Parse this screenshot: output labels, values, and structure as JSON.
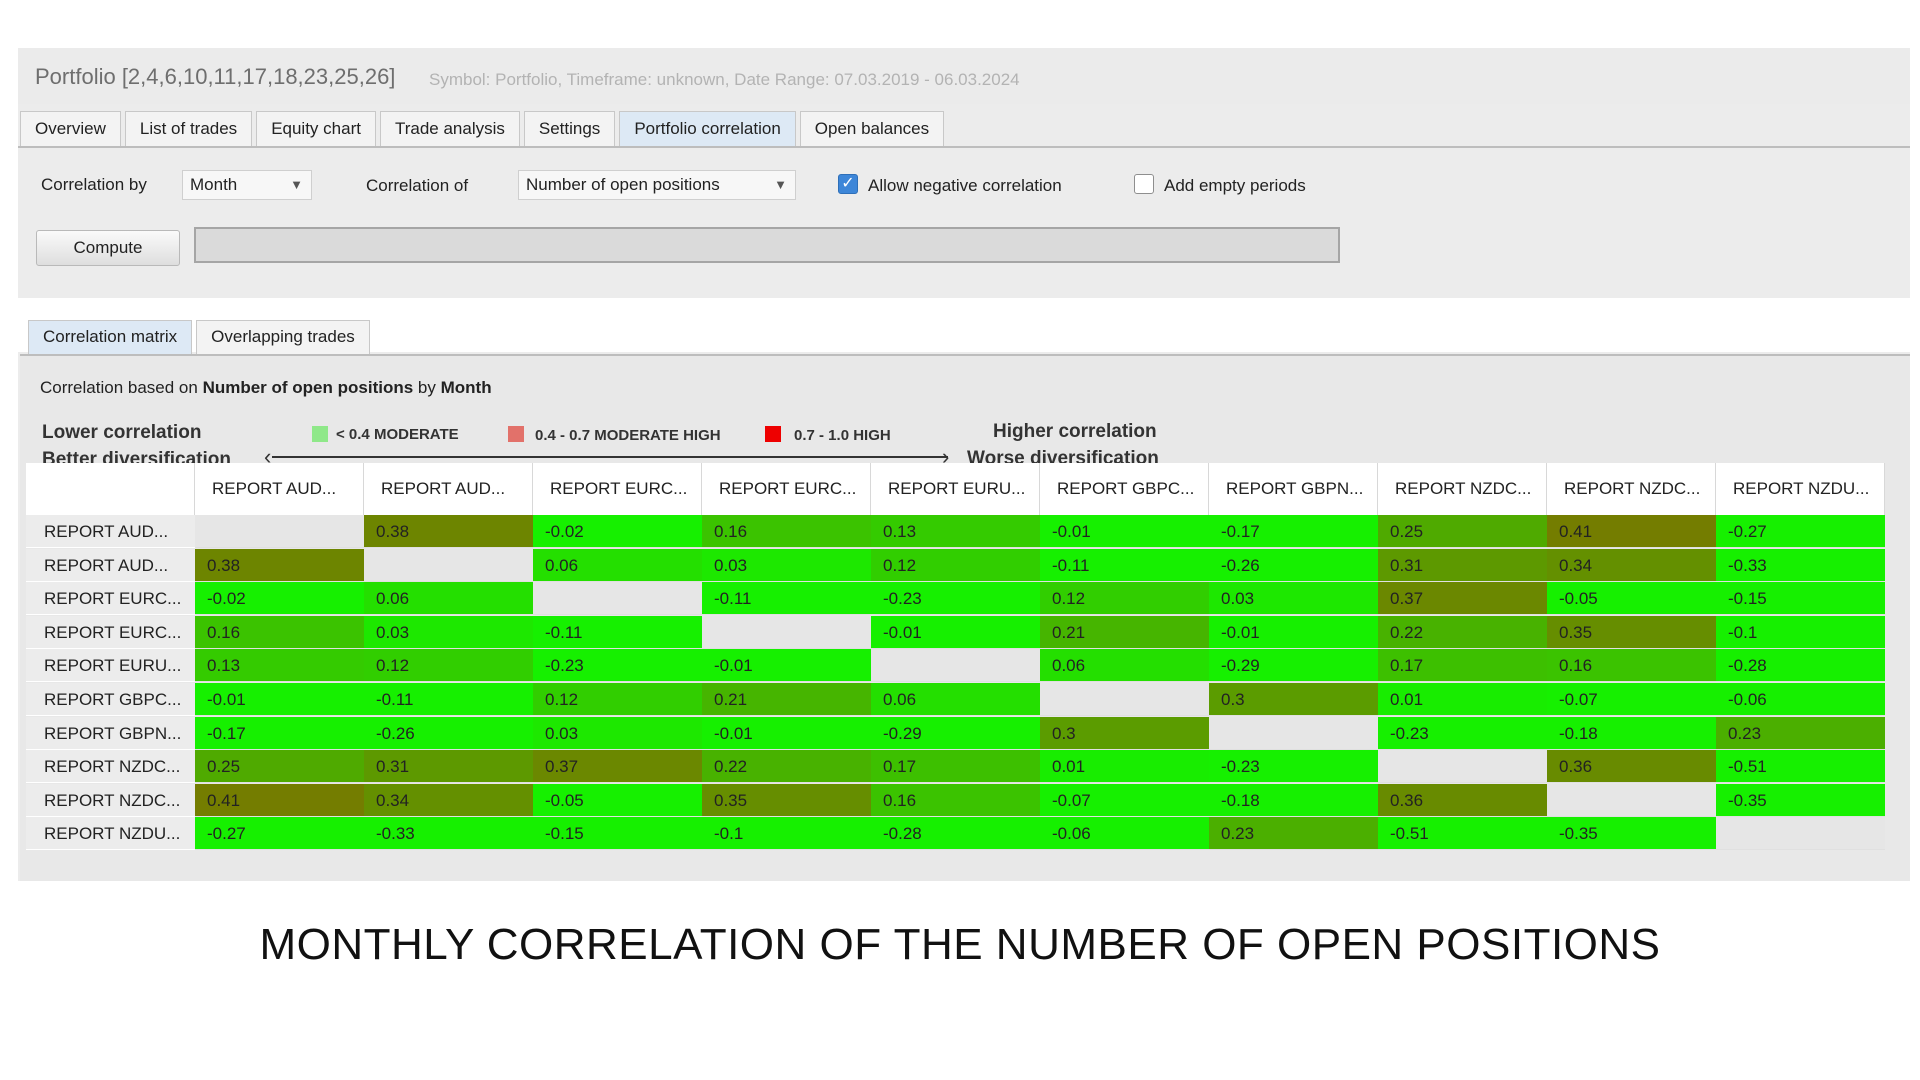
{
  "header": {
    "title": "Portfolio [2,4,6,10,11,17,18,23,25,26]",
    "subtitle": "Symbol: Portfolio, Timeframe: unknown, Date Range: 07.03.2019 - 06.03.2024"
  },
  "tabs": [
    "Overview",
    "List of trades",
    "Equity chart",
    "Trade analysis",
    "Settings",
    "Portfolio correlation",
    "Open balances"
  ],
  "active_tab": "Portfolio correlation",
  "controls": {
    "correlation_by_label": "Correlation by",
    "correlation_by_value": "Month",
    "correlation_of_label": "Correlation of",
    "correlation_of_value": "Number of open positions",
    "allow_negative_label": "Allow negative correlation",
    "allow_negative_checked": true,
    "add_empty_label": "Add empty periods",
    "add_empty_checked": false,
    "compute_label": "Compute"
  },
  "subtabs": [
    "Correlation matrix",
    "Overlapping trades"
  ],
  "active_subtab": "Correlation matrix",
  "basis": {
    "prefix": "Correlation based on",
    "measure": "Number of open positions",
    "by": "by",
    "period": "Month"
  },
  "legend": {
    "lower_1": "Lower correlation",
    "lower_2": "Better diversification",
    "higher_1": "Higher correlation",
    "higher_2": "Worse diversification",
    "items": [
      {
        "label": "< 0.4 MODERATE",
        "color": "#8fe889"
      },
      {
        "label": "0.4 - 0.7 MODERATE HIGH",
        "color": "#e2716a"
      },
      {
        "label": "0.7 - 1.0 HIGH",
        "color": "#ee0000"
      }
    ]
  },
  "matrix": {
    "columns": [
      "REPORT AUD...",
      "REPORT AUD...",
      "REPORT EURC...",
      "REPORT EURC...",
      "REPORT EURU...",
      "REPORT GBPC...",
      "REPORT GBPN...",
      "REPORT NZDC...",
      "REPORT NZDC...",
      "REPORT NZDU..."
    ],
    "rows": [
      {
        "label": "REPORT AUD...",
        "values": [
          "",
          "0.38",
          "-0.02",
          "0.16",
          "0.13",
          "-0.01",
          "-0.17",
          "0.25",
          "0.41",
          "-0.27"
        ]
      },
      {
        "label": "REPORT AUD...",
        "values": [
          "0.38",
          "",
          "0.06",
          "0.03",
          "0.12",
          "-0.11",
          "-0.26",
          "0.31",
          "0.34",
          "-0.33"
        ]
      },
      {
        "label": "REPORT EURC...",
        "values": [
          "-0.02",
          "0.06",
          "",
          "-0.11",
          "-0.23",
          "0.12",
          "0.03",
          "0.37",
          "-0.05",
          "-0.15"
        ]
      },
      {
        "label": "REPORT EURC...",
        "values": [
          "0.16",
          "0.03",
          "-0.11",
          "",
          "-0.01",
          "0.21",
          "-0.01",
          "0.22",
          "0.35",
          "-0.1"
        ]
      },
      {
        "label": "REPORT EURU...",
        "values": [
          "0.13",
          "0.12",
          "-0.23",
          "-0.01",
          "",
          "0.06",
          "-0.29",
          "0.17",
          "0.16",
          "-0.28"
        ]
      },
      {
        "label": "REPORT GBPC...",
        "values": [
          "-0.01",
          "-0.11",
          "0.12",
          "0.21",
          "0.06",
          "",
          "0.3",
          "0.01",
          "-0.07",
          "-0.06"
        ]
      },
      {
        "label": "REPORT GBPN...",
        "values": [
          "-0.17",
          "-0.26",
          "0.03",
          "-0.01",
          "-0.29",
          "0.3",
          "",
          "-0.23",
          "-0.18",
          "0.23"
        ]
      },
      {
        "label": "REPORT NZDC...",
        "values": [
          "0.25",
          "0.31",
          "0.37",
          "0.22",
          "0.17",
          "0.01",
          "-0.23",
          "",
          "0.36",
          "-0.51"
        ]
      },
      {
        "label": "REPORT NZDC...",
        "values": [
          "0.41",
          "0.34",
          "-0.05",
          "0.35",
          "0.16",
          "-0.07",
          "-0.18",
          "0.36",
          "",
          "-0.35"
        ]
      },
      {
        "label": "REPORT NZDU...",
        "values": [
          "-0.27",
          "-0.33",
          "-0.15",
          "-0.1",
          "-0.28",
          "-0.06",
          "0.23",
          "-0.51",
          "-0.35",
          ""
        ]
      }
    ]
  },
  "caption": "MONTHLY CORRELATION OF THE NUMBER OF OPEN POSITIONS"
}
